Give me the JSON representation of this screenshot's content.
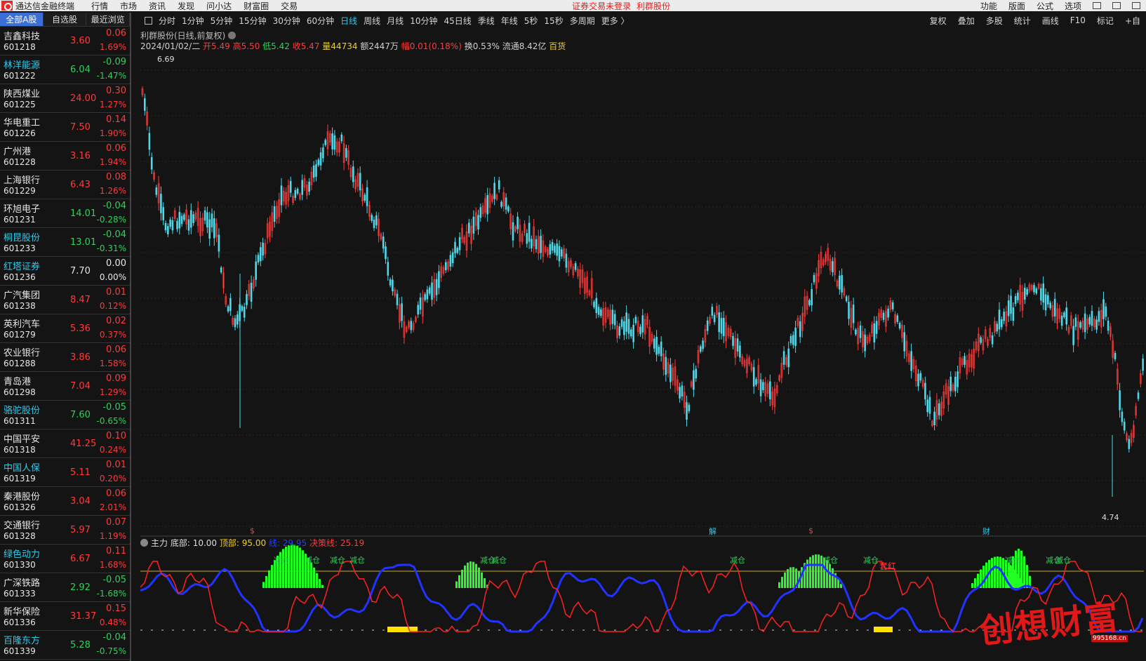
{
  "app": {
    "title": "通达信金融终端",
    "menu": [
      "行情",
      "市场",
      "资讯",
      "发现",
      "问小达",
      "财富圈",
      "交易"
    ],
    "alert": "证券交易未登录",
    "current_stock": "利群股份",
    "right_menu": [
      "功能",
      "版面",
      "公式",
      "选项"
    ]
  },
  "left_tabs": [
    "全部A股",
    "自选股",
    "最近浏览"
  ],
  "stocks": [
    {
      "name": "吉鑫科技",
      "code": "601218",
      "price": "3.60",
      "chg": "0.06",
      "pct": "1.69%",
      "dir": "up",
      "cyan": false
    },
    {
      "name": "林洋能源",
      "code": "601222",
      "price": "6.04",
      "chg": "-0.09",
      "pct": "-1.47%",
      "dir": "down",
      "cyan": true
    },
    {
      "name": "陕西煤业",
      "code": "601225",
      "price": "24.00",
      "chg": "0.30",
      "pct": "1.27%",
      "dir": "up",
      "cyan": false
    },
    {
      "name": "华电重工",
      "code": "601226",
      "price": "7.50",
      "chg": "0.14",
      "pct": "1.90%",
      "dir": "up",
      "cyan": false
    },
    {
      "name": "广州港",
      "code": "601228",
      "price": "3.16",
      "chg": "0.06",
      "pct": "1.94%",
      "dir": "up",
      "cyan": false
    },
    {
      "name": "上海银行",
      "code": "601229",
      "price": "6.43",
      "chg": "0.08",
      "pct": "1.26%",
      "dir": "up",
      "cyan": false
    },
    {
      "name": "环旭电子",
      "code": "601231",
      "price": "14.01",
      "chg": "-0.04",
      "pct": "-0.28%",
      "dir": "down",
      "cyan": false
    },
    {
      "name": "桐昆股份",
      "code": "601233",
      "price": "13.01",
      "chg": "-0.04",
      "pct": "-0.31%",
      "dir": "down",
      "cyan": true
    },
    {
      "name": "红塔证券",
      "code": "601236",
      "price": "7.70",
      "chg": "0.00",
      "pct": "0.00%",
      "dir": "flat",
      "cyan": true
    },
    {
      "name": "广汽集团",
      "code": "601238",
      "price": "8.47",
      "chg": "0.01",
      "pct": "0.12%",
      "dir": "up",
      "cyan": false
    },
    {
      "name": "英利汽车",
      "code": "601279",
      "price": "5.36",
      "chg": "0.02",
      "pct": "0.37%",
      "dir": "up",
      "cyan": false
    },
    {
      "name": "农业银行",
      "code": "601288",
      "price": "3.86",
      "chg": "0.06",
      "pct": "1.58%",
      "dir": "up",
      "cyan": false
    },
    {
      "name": "青岛港",
      "code": "601298",
      "price": "7.04",
      "chg": "0.09",
      "pct": "1.29%",
      "dir": "up",
      "cyan": false
    },
    {
      "name": "骆驼股份",
      "code": "601311",
      "price": "7.60",
      "chg": "-0.05",
      "pct": "-0.65%",
      "dir": "down",
      "cyan": true
    },
    {
      "name": "中国平安",
      "code": "601318",
      "price": "41.25",
      "chg": "0.10",
      "pct": "0.24%",
      "dir": "up",
      "cyan": false
    },
    {
      "name": "中国人保",
      "code": "601319",
      "price": "5.11",
      "chg": "0.01",
      "pct": "0.20%",
      "dir": "up",
      "cyan": true
    },
    {
      "name": "秦港股份",
      "code": "601326",
      "price": "3.04",
      "chg": "0.06",
      "pct": "2.01%",
      "dir": "up",
      "cyan": false
    },
    {
      "name": "交通银行",
      "code": "601328",
      "price": "5.97",
      "chg": "0.07",
      "pct": "1.19%",
      "dir": "up",
      "cyan": false
    },
    {
      "name": "绿色动力",
      "code": "601330",
      "price": "6.67",
      "chg": "0.11",
      "pct": "1.68%",
      "dir": "up",
      "cyan": true
    },
    {
      "name": "广深铁路",
      "code": "601333",
      "price": "2.92",
      "chg": "-0.05",
      "pct": "-1.68%",
      "dir": "down",
      "cyan": false
    },
    {
      "name": "新华保险",
      "code": "601336",
      "price": "31.37",
      "chg": "0.15",
      "pct": "0.48%",
      "dir": "up",
      "cyan": false
    },
    {
      "name": "百隆东方",
      "code": "601339",
      "price": "5.28",
      "chg": "-0.04",
      "pct": "-0.75%",
      "dir": "down",
      "cyan": true
    }
  ],
  "periods": [
    "分时",
    "1分钟",
    "5分钟",
    "15分钟",
    "30分钟",
    "60分钟",
    "日线",
    "周线",
    "月线",
    "10分钟",
    "45日线",
    "季线",
    "年线",
    "5秒",
    "15秒",
    "多周期",
    "更多 〉"
  ],
  "active_period": "日线",
  "toolbar_right": [
    "复权",
    "叠加",
    "多股",
    "统计",
    "画线",
    "F10",
    "标记",
    "+自"
  ],
  "chart_header": "利群股份(日线,前复权)",
  "quote": {
    "date": "2024/01/02/二",
    "open": "开5.49",
    "high": "高5.50",
    "low": "低5.42",
    "close": "收5.47",
    "volume": "量44734",
    "amount": "额2447万",
    "change": "幅0.01(0.18%)",
    "turnover": "换0.53%",
    "float": "流通8.42亿",
    "sector": "百货"
  },
  "price_labels": {
    "high": "6.69",
    "low": "4.74"
  },
  "event_markers": [
    "$",
    "解",
    "$",
    "财"
  ],
  "indicator": {
    "name": "主力",
    "bottom": "底部: 10.00",
    "top": "顶部: 95.00",
    "line": "线: 29.95",
    "decision": "决策线: 25.19",
    "signals": [
      "减仓",
      "减仓",
      "减仓",
      "减仓",
      "减仓",
      "减仓",
      "减仓",
      "减仓",
      "减仓",
      "减仓",
      "减仓",
      "减仓"
    ],
    "extra_label": "套红"
  },
  "watermark": "创想财富",
  "watermark_url": "995168.cn",
  "colors": {
    "up": "#ff3b3b",
    "down": "#2fd15a",
    "cyan": "#33c8e8",
    "accent": "#3b6fd6"
  }
}
